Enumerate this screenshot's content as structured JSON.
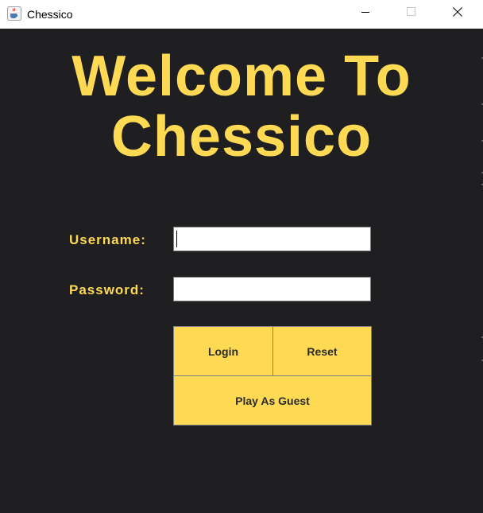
{
  "window": {
    "title": "Chessico",
    "icon": "java-cup-icon",
    "controls": [
      "minimize-icon",
      "maximize-icon",
      "close-icon"
    ]
  },
  "heading": {
    "line1": "Welcome To",
    "line2": "Chessico"
  },
  "form": {
    "username_label": "Username:",
    "username_value": "",
    "password_label": "Password:",
    "password_value": ""
  },
  "buttons": {
    "login": "Login",
    "reset": "Reset",
    "guest": "Play As Guest"
  },
  "colors": {
    "background": "#1f1f21",
    "accent": "#fed954",
    "button_text": "#2b2b2b",
    "button_border": "#7b7f86"
  }
}
